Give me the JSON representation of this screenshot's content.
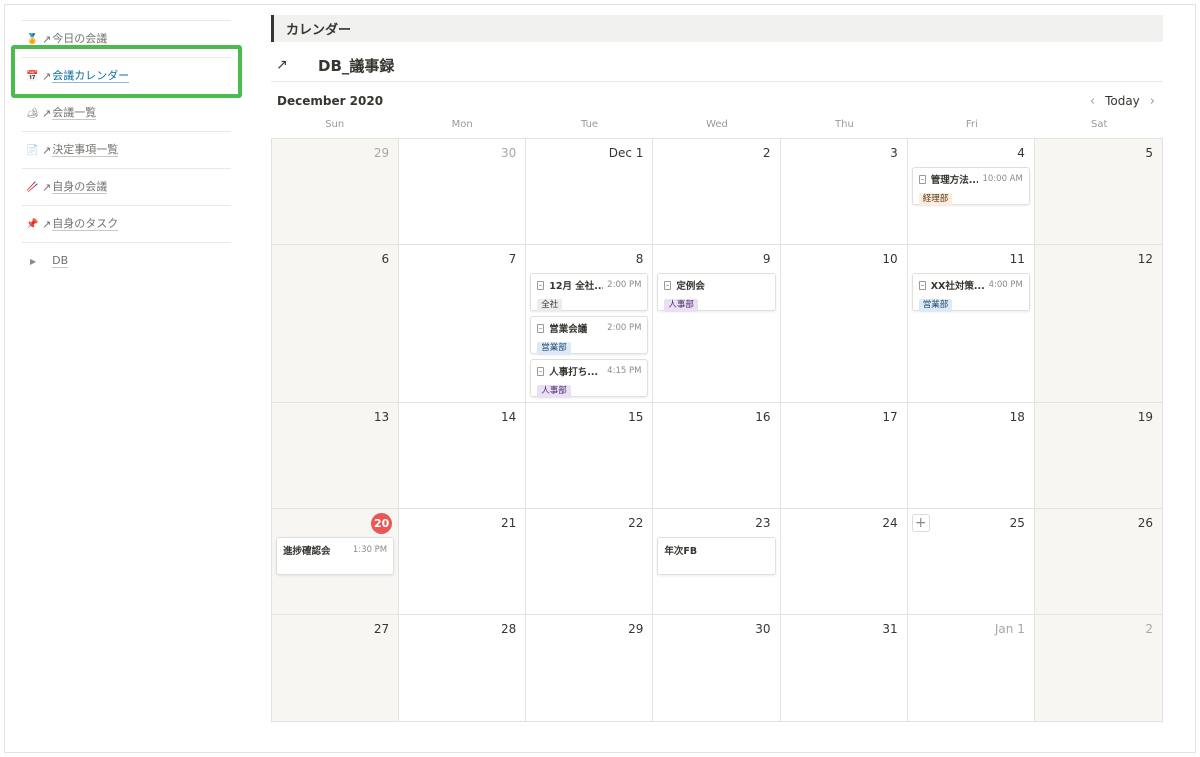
{
  "sidebar": {
    "items": [
      {
        "icon": "🏅",
        "arrow": "↗",
        "label": "今日の会議",
        "active": false
      },
      {
        "icon": "📅",
        "arrow": "↗",
        "label": "会議カレンダー",
        "active": true
      },
      {
        "icon": "🏕",
        "arrow": "↗",
        "label": "会議一覧",
        "active": false
      },
      {
        "icon": "📄",
        "arrow": "↗",
        "label": "決定事項一覧",
        "active": false
      },
      {
        "icon": "🥢",
        "arrow": "↗",
        "label": "自身の会議",
        "active": false
      },
      {
        "icon": "📌",
        "arrow": "↗",
        "label": "自身のタスク",
        "active": false
      }
    ],
    "db_toggle": {
      "triangle": "▶",
      "label": "DB"
    }
  },
  "section_title": "カレンダー",
  "database": {
    "arrow": "↗",
    "title": "DB_議事録"
  },
  "calendar": {
    "month_label": "December 2020",
    "today_button": "Today",
    "prev": "‹",
    "next": "›",
    "weekdays": [
      "Sun",
      "Mon",
      "Tue",
      "Wed",
      "Thu",
      "Fri",
      "Sat"
    ],
    "weeks": [
      [
        {
          "day": "29",
          "other": true
        },
        {
          "day": "30",
          "other": true
        },
        {
          "day": "Dec 1"
        },
        {
          "day": "2"
        },
        {
          "day": "3"
        },
        {
          "day": "4",
          "events": [
            {
              "title": "管理方法...",
              "time": "10:00 AM",
              "tag": "経理部",
              "tag_color": "orange",
              "doc": true
            }
          ]
        },
        {
          "day": "5"
        }
      ],
      [
        {
          "day": "6"
        },
        {
          "day": "7"
        },
        {
          "day": "8",
          "events": [
            {
              "title": "12月 全社...",
              "time": "2:00 PM",
              "tag": "全社",
              "tag_color": "gray",
              "doc": true
            },
            {
              "title": "営業会議",
              "time": "2:00 PM",
              "tag": "営業部",
              "tag_color": "blue",
              "doc": true
            },
            {
              "title": "人事打ち...",
              "time": "4:15 PM",
              "tag": "人事部",
              "tag_color": "purple",
              "doc": true
            }
          ]
        },
        {
          "day": "9",
          "events": [
            {
              "title": "定例会",
              "time": "",
              "tag": "人事部",
              "tag_color": "purple",
              "doc": true
            }
          ]
        },
        {
          "day": "10"
        },
        {
          "day": "11",
          "events": [
            {
              "title": "XX社対策...",
              "time": "4:00 PM",
              "tag": "営業部",
              "tag_color": "blue",
              "doc": true
            }
          ]
        },
        {
          "day": "12"
        }
      ],
      [
        {
          "day": "13"
        },
        {
          "day": "14"
        },
        {
          "day": "15"
        },
        {
          "day": "16"
        },
        {
          "day": "17"
        },
        {
          "day": "18"
        },
        {
          "day": "19"
        }
      ],
      [
        {
          "day": "20",
          "today": true,
          "events": [
            {
              "title": "進捗確認会",
              "time": "1:30 PM",
              "tag": "",
              "doc": false
            }
          ]
        },
        {
          "day": "21"
        },
        {
          "day": "22"
        },
        {
          "day": "23",
          "events": [
            {
              "title": "年次FB",
              "time": "",
              "tag": "",
              "doc": false
            }
          ]
        },
        {
          "day": "24"
        },
        {
          "day": "25",
          "add": "+"
        },
        {
          "day": "26"
        }
      ],
      [
        {
          "day": "27"
        },
        {
          "day": "28"
        },
        {
          "day": "29"
        },
        {
          "day": "30"
        },
        {
          "day": "31"
        },
        {
          "day": "Jan 1",
          "other": true
        },
        {
          "day": "2",
          "other": true
        }
      ]
    ]
  }
}
